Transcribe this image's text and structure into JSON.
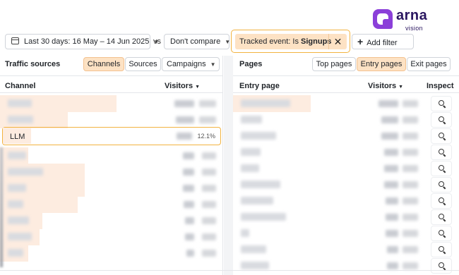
{
  "brand": {
    "name": "arna",
    "tagline": "vision",
    "color": "#2a1660",
    "mark_color": "#8b3fd9"
  },
  "toolbar": {
    "date_range": "Last 30 days: 16 May – 14 Jun 2025",
    "vs": "vs",
    "compare": "Don't compare",
    "filter_prefix": "Tracked event: Is ",
    "filter_value": "Signups",
    "add_filter": "Add filter"
  },
  "traffic": {
    "title": "Traffic sources",
    "tabs": [
      "Channels",
      "Sources",
      "Campaigns"
    ],
    "active_tab": "Channels",
    "col_channel": "Channel",
    "col_visitors": "Visitors",
    "highlight_row": {
      "label": "LLM",
      "pct": "12.1%"
    }
  },
  "pages": {
    "title": "Pages",
    "tabs": [
      "Top pages",
      "Entry pages",
      "Exit pages"
    ],
    "active_tab": "Entry pages",
    "col_page": "Entry page",
    "col_visitors": "Visitors",
    "col_inspect": "Inspect"
  },
  "colors": {
    "accent": "#f2b340",
    "active_bg": "#fde2c4",
    "bar_bg": "#fdece0"
  }
}
